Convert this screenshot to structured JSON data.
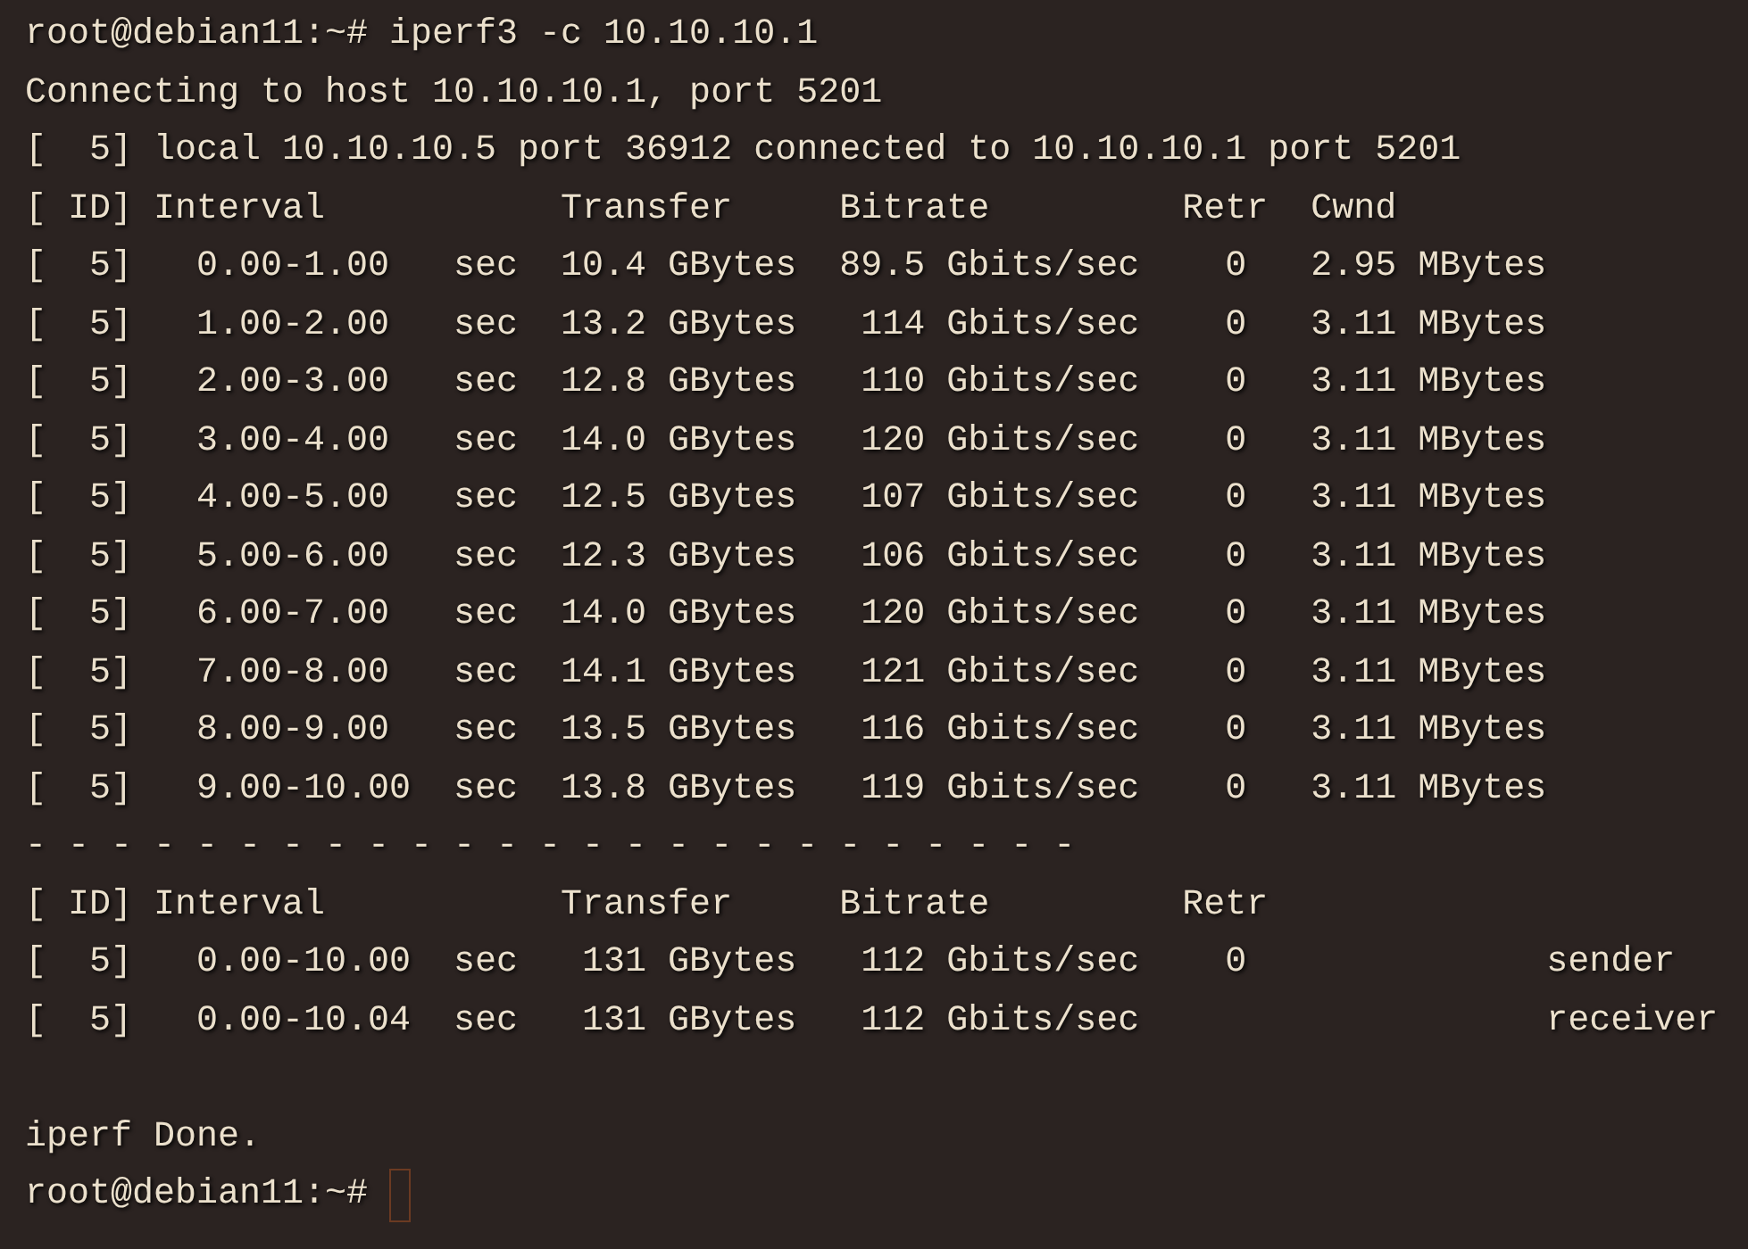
{
  "output": [
    "root@debian11:~# iperf3 -c 10.10.10.1",
    "Connecting to host 10.10.10.1, port 5201",
    "[  5] local 10.10.10.5 port 36912 connected to 10.10.10.1 port 5201",
    "[ ID] Interval           Transfer     Bitrate         Retr  Cwnd",
    "[  5]   0.00-1.00   sec  10.4 GBytes  89.5 Gbits/sec    0   2.95 MBytes",
    "[  5]   1.00-2.00   sec  13.2 GBytes   114 Gbits/sec    0   3.11 MBytes",
    "[  5]   2.00-3.00   sec  12.8 GBytes   110 Gbits/sec    0   3.11 MBytes",
    "[  5]   3.00-4.00   sec  14.0 GBytes   120 Gbits/sec    0   3.11 MBytes",
    "[  5]   4.00-5.00   sec  12.5 GBytes   107 Gbits/sec    0   3.11 MBytes",
    "[  5]   5.00-6.00   sec  12.3 GBytes   106 Gbits/sec    0   3.11 MBytes",
    "[  5]   6.00-7.00   sec  14.0 GBytes   120 Gbits/sec    0   3.11 MBytes",
    "[  5]   7.00-8.00   sec  14.1 GBytes   121 Gbits/sec    0   3.11 MBytes",
    "[  5]   8.00-9.00   sec  13.5 GBytes   116 Gbits/sec    0   3.11 MBytes",
    "[  5]   9.00-10.00  sec  13.8 GBytes   119 Gbits/sec    0   3.11 MBytes",
    "- - - - - - - - - - - - - - - - - - - - - - - - -",
    "[ ID] Interval           Transfer     Bitrate         Retr",
    "[  5]   0.00-10.00  sec   131 GBytes   112 Gbits/sec    0              sender",
    "[  5]   0.00-10.04  sec   131 GBytes   112 Gbits/sec                   receiver"
  ],
  "result": [
    "iperf Done."
  ],
  "prompt": {
    "text": "root@debian11:~#",
    "cursor": true
  }
}
